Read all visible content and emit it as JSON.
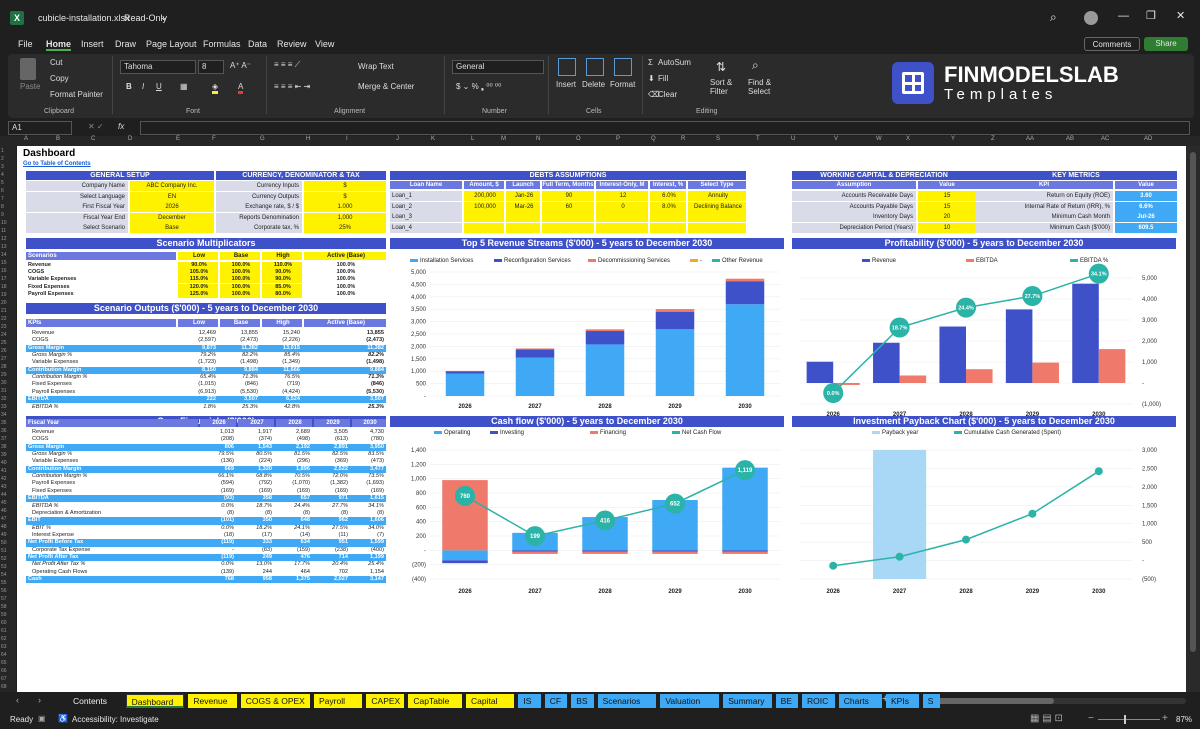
{
  "window": {
    "filename": "cubicle-installation.xlsx",
    "mode": "Read-Only"
  },
  "menu": [
    "File",
    "Home",
    "Insert",
    "Draw",
    "Page Layout",
    "Formulas",
    "Data",
    "Review",
    "View"
  ],
  "menu_right": {
    "comments": "Comments",
    "share": "Share"
  },
  "ribbon": {
    "paste": "Paste",
    "cut": "Cut",
    "copy": "Copy",
    "format_painter": "Format Painter",
    "clipboard": "Clipboard",
    "font_name": "Tahoma",
    "font_size": "8",
    "font": "Font",
    "wrap": "Wrap Text",
    "merge": "Merge & Center",
    "alignment": "Alignment",
    "number_format": "General",
    "number": "Number",
    "insert": "Insert",
    "delete": "Delete",
    "format": "Format",
    "cells": "Cells",
    "autosum": "AutoSum",
    "fill": "Fill",
    "clear": "Clear",
    "sort": "Sort & Filter",
    "find": "Find & Select",
    "editing": "Editing"
  },
  "logo": {
    "title": "FINMODELSLAB",
    "sub": "Templates"
  },
  "formula_bar": {
    "cell_ref": "A1",
    "fx": "fx"
  },
  "columns": [
    "A",
    "B",
    "C",
    "D",
    "E",
    "F",
    "G",
    "H",
    "I",
    "J",
    "K",
    "L",
    "M",
    "N",
    "O",
    "P",
    "Q",
    "R",
    "S",
    "T",
    "U",
    "V",
    "W",
    "X",
    "Y",
    "Z",
    "AA",
    "AB",
    "AC",
    "AD"
  ],
  "sheet": {
    "title": "Dashboard",
    "toc": "Go to Table of Contents",
    "general": {
      "title": "GENERAL SETUP",
      "rows": [
        [
          "Company Name",
          "ABC Company Inc."
        ],
        [
          "Select Language",
          "EN"
        ],
        [
          "First Fiscal Year",
          "2026"
        ],
        [
          "Fiscal Year End",
          "December"
        ],
        [
          "Select Scenario",
          "Base"
        ]
      ]
    },
    "currency": {
      "title": "CURRENCY, DENOMINATOR & TAX",
      "rows": [
        [
          "Currency Inputs",
          "$"
        ],
        [
          "Currency Outputs",
          "$"
        ],
        [
          "Exchange rate, $ / $",
          "1.000"
        ],
        [
          "Reports Denomination",
          "1,000"
        ],
        [
          "Corporate tax, %",
          "25%"
        ]
      ]
    },
    "debts": {
      "title": "DEBTS ASSUMPTIONS",
      "headers": [
        "Loan Name",
        "Amount, $",
        "Launch",
        "Full Term, Months",
        "Interest-Only, M",
        "Interest, %",
        "Select Type"
      ],
      "rows": [
        [
          "Loan_1",
          "200,000",
          "Jan-26",
          "90",
          "12",
          "6.0%",
          "Annuity"
        ],
        [
          "Loan_2",
          "100,000",
          "Mar-26",
          "60",
          "0",
          "8.0%",
          "Declining Balance"
        ],
        [
          "Loan_3",
          "",
          "",
          "",
          "",
          "",
          ""
        ],
        [
          "Loan_4",
          "",
          "",
          "",
          "",
          "",
          ""
        ]
      ]
    },
    "wc": {
      "title": "WORKING CAPITAL & DEPRECIATION",
      "headers": [
        "Assumption",
        "Value"
      ],
      "rows": [
        [
          "Accounts Receivable Days",
          "15"
        ],
        [
          "Accounts Payable Days",
          "15"
        ],
        [
          "Inventory Days",
          "20"
        ],
        [
          "Depreciation Period (Years)",
          "10"
        ]
      ]
    },
    "kpi": {
      "title": "KEY METRICS",
      "headers": [
        "KPI",
        "Value"
      ],
      "rows": [
        [
          "Return on Equity (ROE)",
          "3.60"
        ],
        [
          "Internal Rate of Return (IRR), %",
          "6.6%"
        ],
        [
          "Minimum Cash Month",
          "Jul-26"
        ],
        [
          "Minimum Cash ($'000)",
          "609.5"
        ]
      ]
    },
    "scen_mult": {
      "title": "Scenario Multiplicators",
      "headers": [
        "Scenarios",
        "Low",
        "Base",
        "High",
        "Active (Base)"
      ],
      "rows": [
        [
          "Revenue",
          "90.0%",
          "100.0%",
          "110.0%",
          "100.0%"
        ],
        [
          "COGS",
          "105.0%",
          "100.0%",
          "90.0%",
          "100.0%"
        ],
        [
          "Variable Expenses",
          "115.0%",
          "100.0%",
          "90.0%",
          "100.0%"
        ],
        [
          "Fixed Expenses",
          "120.0%",
          "100.0%",
          "85.0%",
          "100.0%"
        ],
        [
          "Payroll Expenses",
          "125.0%",
          "100.0%",
          "80.0%",
          "100.0%"
        ]
      ]
    },
    "scen_out": {
      "title": "Scenario Outputs ($'000) - 5 years to December 2030",
      "headers": [
        "KPIs",
        "Low",
        "Base",
        "High",
        "Active (Base)"
      ],
      "rows": [
        [
          "Revenue",
          "12,469",
          "13,855",
          "15,240",
          "13,855",
          "n"
        ],
        [
          "COGS",
          "(2,597)",
          "(2,473)",
          "(2,226)",
          "(2,473)",
          "n"
        ],
        [
          "Gross Margin",
          "9,873",
          "11,382",
          "13,015",
          "11,382",
          "b"
        ],
        [
          "Gross Margin %",
          "79.2%",
          "82.2%",
          "85.4%",
          "82.2%",
          "i"
        ],
        [
          "Variable Expenses",
          "(1,723)",
          "(1,498)",
          "(1,349)",
          "(1,498)",
          "n"
        ],
        [
          "Contribution Margin",
          "8,150",
          "9,884",
          "11,666",
          "9,884",
          "b"
        ],
        [
          "Contribution Margin %",
          "65.4%",
          "71.3%",
          "76.5%",
          "71.3%",
          "i"
        ],
        [
          "Fixed Expenses",
          "(1,015)",
          "(846)",
          "(719)",
          "(846)",
          "n"
        ],
        [
          "Payroll Expenses",
          "(6,913)",
          "(5,530)",
          "(4,424)",
          "(5,530)",
          "n"
        ],
        [
          "EBITDA",
          "222",
          "3,507",
          "6,524",
          "3,507",
          "b"
        ],
        [
          "EBITDA %",
          "1.8%",
          "25.3%",
          "42.8%",
          "25.3%",
          "i"
        ]
      ]
    },
    "core": {
      "title": "Core Financials ($'000)",
      "headers": [
        "Fiscal Year",
        "2026",
        "2027",
        "2028",
        "2029",
        "2030"
      ],
      "rows": [
        [
          "Revenue",
          "1,013",
          "1,917",
          "2,689",
          "3,505",
          "4,730",
          "n"
        ],
        [
          "COGS",
          "(208)",
          "(374)",
          "(498)",
          "(613)",
          "(780)",
          "n"
        ],
        [
          "Gross Margin",
          "806",
          "1,543",
          "2,192",
          "2,891",
          "3,950",
          "b"
        ],
        [
          "Gross Margin %",
          "79.5%",
          "80.5%",
          "81.5%",
          "82.5%",
          "83.5%",
          "i"
        ],
        [
          "Variable Expenses",
          "(136)",
          "(224)",
          "(296)",
          "(369)",
          "(473)",
          "n"
        ],
        [
          "Contribution Margin",
          "669",
          "1,320",
          "1,896",
          "2,522",
          "3,477",
          "b"
        ],
        [
          "Contribution Margin %",
          "66.1%",
          "68.8%",
          "70.5%",
          "72.0%",
          "73.5%",
          "i"
        ],
        [
          "Payroll Expenses",
          "(594)",
          "(792)",
          "(1,070)",
          "(1,382)",
          "(1,693)",
          "n"
        ],
        [
          "Fixed Expenses",
          "(169)",
          "(169)",
          "(169)",
          "(169)",
          "(169)",
          "n"
        ],
        [
          "EBITDA",
          "(93)",
          "358",
          "657",
          "971",
          "1,615",
          "b"
        ],
        [
          "EBITDA %",
          "0.0%",
          "18.7%",
          "24.4%",
          "27.7%",
          "34.1%",
          "i"
        ],
        [
          "Depreciation & Amortization",
          "(8)",
          "(8)",
          "(8)",
          "(8)",
          "(8)",
          "n"
        ],
        [
          "EBIT",
          "(101)",
          "350",
          "648",
          "962",
          "1,606",
          "b"
        ],
        [
          "EBIT %",
          "0.0%",
          "18.2%",
          "24.1%",
          "27.5%",
          "34.0%",
          "i"
        ],
        [
          "Interest Expense",
          "(18)",
          "(17)",
          "(14)",
          "(11)",
          "(7)",
          "n"
        ],
        [
          "Net Profit Before Tax",
          "(119)",
          "333",
          "634",
          "951",
          "1,599",
          "b"
        ],
        [
          "Corporate Tax Expense",
          "-",
          "(83)",
          "(159)",
          "(238)",
          "(400)",
          "n"
        ],
        [
          "Net Profit After Tax",
          "(119)",
          "249",
          "476",
          "714",
          "1,199",
          "b"
        ],
        [
          "Net Profit After Tax %",
          "0.0%",
          "13.0%",
          "17.7%",
          "20.4%",
          "25.4%",
          "i"
        ],
        [
          "Operating Cash Flows",
          "(139)",
          "244",
          "464",
          "702",
          "1,154",
          "n"
        ],
        [
          "Cash",
          "768",
          "958",
          "1,375",
          "2,027",
          "3,147",
          "b"
        ]
      ]
    }
  },
  "chart_data": [
    {
      "type": "bar",
      "title": "Top 5 Revenue Streams ($'000) - 5 years to December 2030",
      "categories": [
        "2026",
        "2027",
        "2028",
        "2029",
        "2030"
      ],
      "series": [
        {
          "name": "Installation Services",
          "values": [
            900,
            1550,
            2080,
            2690,
            3700
          ],
          "color": "#3fa9f5"
        },
        {
          "name": "Reconfiguration Services",
          "values": [
            100,
            330,
            540,
            710,
            930
          ],
          "color": "#3f51c8"
        },
        {
          "name": "Decommissioning Services",
          "values": [
            13,
            37,
            69,
            105,
            100
          ],
          "color": "#ef7a6b"
        },
        {
          "name": "-",
          "values": [
            0,
            0,
            0,
            0,
            0
          ],
          "color": "#f5a623"
        },
        {
          "name": "Other Revenue",
          "values": [
            0,
            0,
            0,
            0,
            0
          ],
          "color": "#2ab3a6"
        }
      ],
      "yticks": [
        "5,000",
        "4,500",
        "4,000",
        "3,500",
        "3,000",
        "2,500",
        "2,000",
        "1,500",
        "1,000",
        "500",
        "-"
      ],
      "ylim": [
        0,
        5000
      ]
    },
    {
      "type": "bar",
      "title": "Profitability ($'000) - 5 years to December 2030",
      "categories": [
        "2026",
        "2027",
        "2028",
        "2029",
        "2030"
      ],
      "series": [
        {
          "name": "Revenue",
          "values": [
            1013,
            1917,
            2689,
            3505,
            4730
          ],
          "color": "#3f51c8"
        },
        {
          "name": "EBITDA",
          "values": [
            -93,
            358,
            657,
            971,
            1615
          ],
          "color": "#ef7a6b"
        },
        {
          "name": "EBITDA %",
          "values": [
            0.0,
            18.7,
            24.4,
            27.7,
            34.1
          ],
          "labels": [
            "0.0%",
            "18.7%",
            "24.4%",
            "27.7%",
            "34.1%"
          ],
          "color": "#2ab3a6"
        }
      ],
      "yticks": [
        "5,000",
        "4,000",
        "3,000",
        "2,000",
        "1,000",
        "-",
        "(1,000)"
      ],
      "ylim": [
        -1000,
        5000
      ]
    },
    {
      "type": "bar",
      "title": "Cash flow ($'000) - 5 years to December 2030",
      "categories": [
        "2026",
        "2027",
        "2028",
        "2029",
        "2030"
      ],
      "series": [
        {
          "name": "Operating",
          "values": [
            -139,
            244,
            464,
            702,
            1154
          ],
          "color": "#3fa9f5"
        },
        {
          "name": "Investing",
          "values": [
            -40,
            -20,
            -20,
            -20,
            -20
          ],
          "color": "#3f51c8"
        },
        {
          "name": "Financing",
          "values": [
            980,
            -30,
            -30,
            -30,
            -30
          ],
          "color": "#ef7a6b"
        },
        {
          "name": "Net Cash Flow",
          "values": [
            760,
            199,
            416,
            652,
            1119
          ],
          "color": "#2ab3a6"
        }
      ],
      "yticks": [
        "1,400",
        "1,200",
        "1,000",
        "800",
        "600",
        "400",
        "200",
        "-",
        "(200)",
        "(400)"
      ],
      "ylim": [
        -400,
        1400
      ]
    },
    {
      "type": "line",
      "title": "Investment Payback Chart ($'000) - 5 years to December 2030",
      "categories": [
        "2026",
        "2027",
        "2028",
        "2029",
        "2030"
      ],
      "series": [
        {
          "name": "Payback year",
          "values": [
            0,
            1,
            0,
            0,
            0
          ],
          "color": "#a8d8f5"
        },
        {
          "name": "Cumulative Cash Generated (Spent)",
          "values": [
            -139,
            105,
            569,
            1271,
            2425
          ],
          "color": "#2ab3a6"
        }
      ],
      "yticks": [
        "3,000",
        "2,500",
        "2,000",
        "1,500",
        "1,000",
        "500",
        "-",
        "(500)"
      ],
      "ylim": [
        -500,
        3000
      ]
    }
  ],
  "tabs": [
    "Contents",
    "Dashboard",
    "Revenue",
    "COGS & OPEX",
    "Payroll",
    "CAPEX",
    "CapTable",
    "Capital",
    "IS",
    "CF",
    "BS",
    "Scenarios",
    "Valuation",
    "Summary",
    "BE",
    "ROIC",
    "Charts",
    "KPIs",
    "S"
  ],
  "statusbar": {
    "ready": "Ready",
    "accessibility": "Accessibility: Investigate",
    "zoom": "87%"
  }
}
